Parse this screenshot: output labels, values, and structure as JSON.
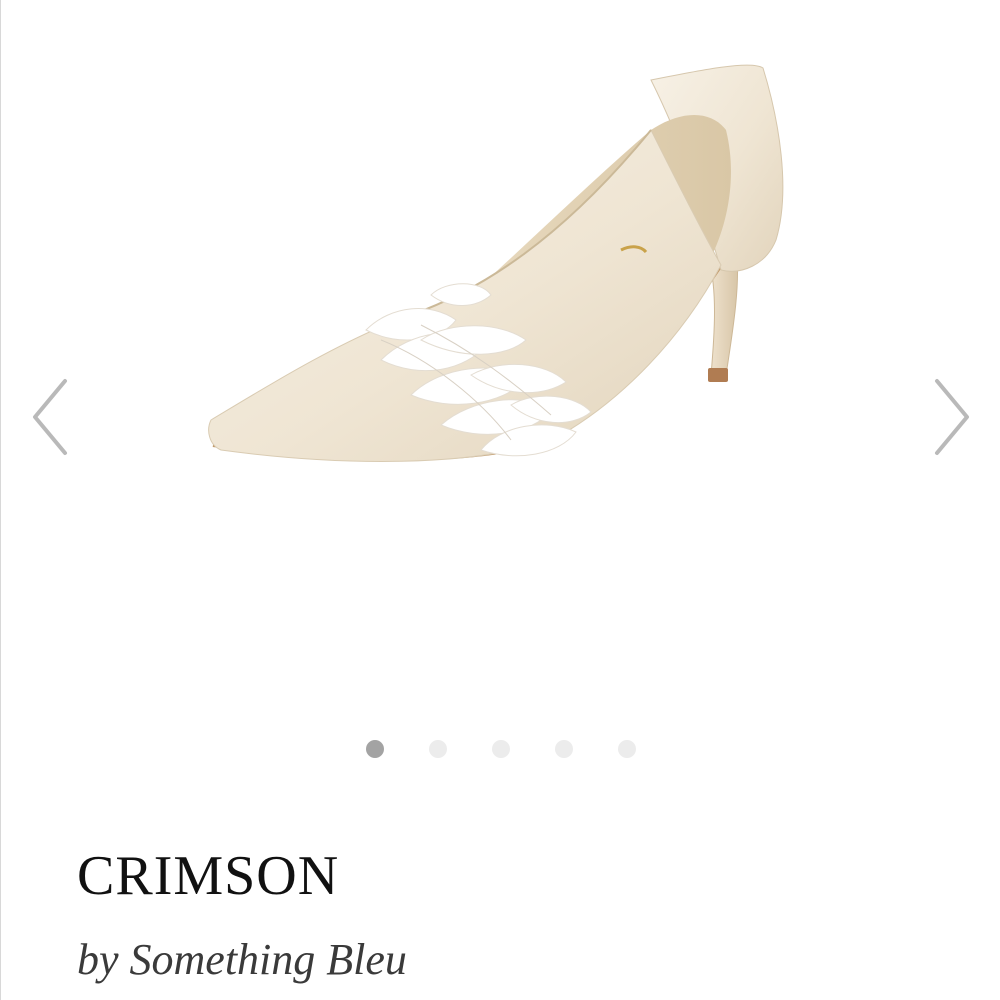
{
  "product": {
    "name": "CRIMSON",
    "byline": "by Something Bleu"
  },
  "carousel": {
    "image_subject": "ivory satin pointed-toe pump with white feather trim",
    "prev_icon": "chevron-left-icon",
    "next_icon": "chevron-right-icon",
    "slide_count": 5,
    "active_slide": 1
  },
  "colors": {
    "arrow": "#b9b9b9",
    "dot_active": "#a3a3a3",
    "dot_inactive": "#ececec",
    "title_text": "#111111",
    "byline_text": "#3a3a3a"
  }
}
